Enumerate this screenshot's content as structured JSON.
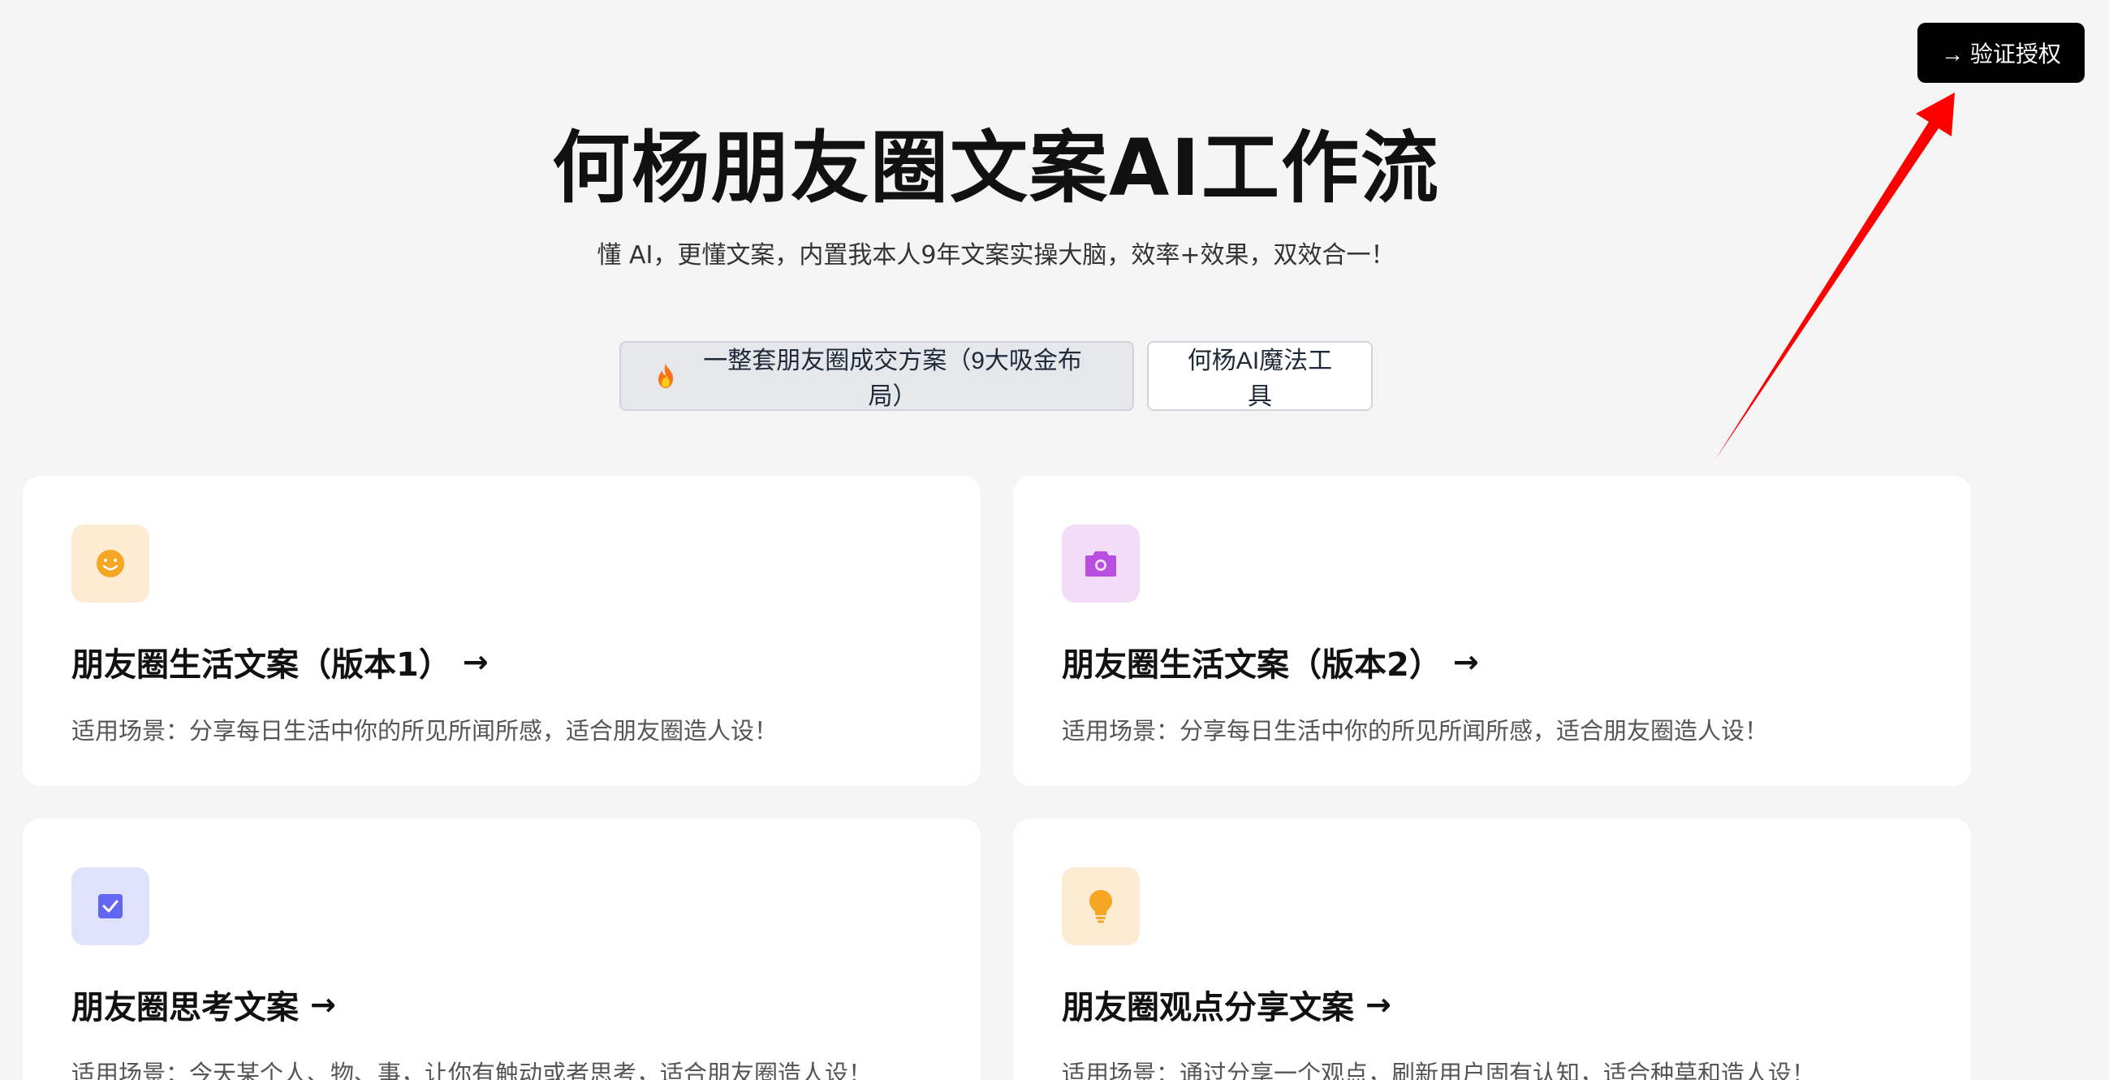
{
  "auth_button": {
    "label": "→ 验证授权"
  },
  "hero": {
    "title": "何杨朋友圈文案AI工作流",
    "subtitle": "懂 AI，更懂文案，内置我本人9年文案实操大脑，效率+效果，双效合一！"
  },
  "actions": {
    "primary_label": "一整套朋友圈成交方案（9大吸金布局）",
    "primary_icon": "fire-icon",
    "secondary_label": "何杨AI魔法工具"
  },
  "cards": [
    {
      "title": "朋友圈生活文案（版本1）",
      "arrow": "→",
      "desc": "适用场景：分享每日生活中你的所见所闻所感，适合朋友圈造人设！",
      "icon": "smiley-icon",
      "icon_bg": "#fdecd2",
      "icon_color": "#f5a623"
    },
    {
      "title": "朋友圈生活文案（版本2）",
      "arrow": "→",
      "desc": "适用场景：分享每日生活中你的所见所闻所感，适合朋友圈造人设！",
      "icon": "camera-icon",
      "icon_bg": "#f3dcf8",
      "icon_color": "#b84fe0"
    },
    {
      "title": "朋友圈思考文案",
      "arrow": "→",
      "desc": "适用场景：今天某个人、物、事，让你有触动或者思考，适合朋友圈造人设！",
      "icon": "checkbox-icon",
      "icon_bg": "#e0e2fb",
      "icon_color": "#6366f1"
    },
    {
      "title": "朋友圈观点分享文案",
      "arrow": "→",
      "desc": "适用场景：通过分享一个观点，刷新用户固有认知，适合种草和造人设！",
      "icon": "lightbulb-icon",
      "icon_bg": "#fdecd2",
      "icon_color": "#f5a623"
    }
  ],
  "colors": {
    "background": "#f5f5f5",
    "auth_button_bg": "#000000",
    "annotation_arrow": "#ff0000"
  }
}
